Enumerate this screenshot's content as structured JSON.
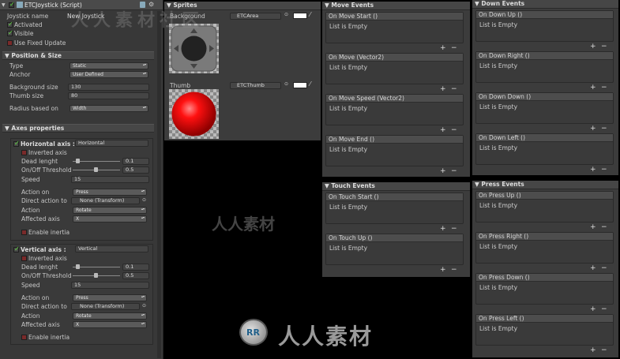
{
  "inspector": {
    "title": "ETCJoystick (Script)",
    "joystick_name_label": "Joystick name",
    "joystick_name_value": "New Joystick",
    "activated": "Activated",
    "visible": "Visible",
    "use_fixed_update": "Use Fixed Update",
    "position_size": {
      "title": "Position & Size",
      "type_label": "Type",
      "type_value": "Static",
      "anchor_label": "Anchor",
      "anchor_value": "User Defined",
      "bg_size_label": "Background size",
      "bg_size_value": "130",
      "thumb_size_label": "Thumb size",
      "thumb_size_value": "80",
      "radius_label": "Radius based on",
      "radius_value": "Width"
    },
    "axes": {
      "title": "Axes properties",
      "horizontal": {
        "title": "Horizontal axis :",
        "name": "Horizontal",
        "inverted": "Inverted axis",
        "dead_label": "Dead lenght",
        "dead_value": "0.1",
        "thresh_label": "On/Off Threshold",
        "thresh_value": "0.5",
        "speed_label": "Speed",
        "speed_value": "15",
        "action_on_label": "Action on",
        "action_on_value": "Press",
        "direct_label": "Direct action to",
        "direct_value": "None (Transform)",
        "action_label": "Action",
        "action_value": "Rotate",
        "affected_label": "Affected axis",
        "affected_value": "X",
        "inertia": "Enable inertia"
      },
      "vertical": {
        "title": "Vertical axis :",
        "name": "Vertical",
        "inverted": "Inverted axis",
        "dead_label": "Dead lenght",
        "dead_value": "0.1",
        "thresh_label": "On/Off Threshold",
        "thresh_value": "0.5",
        "speed_label": "Speed",
        "speed_value": "15",
        "action_on_label": "Action on",
        "action_on_value": "Press",
        "direct_label": "Direct action to",
        "direct_value": "None (Transform)",
        "action_label": "Action",
        "action_value": "Rotate",
        "affected_label": "Affected axis",
        "affected_value": "X",
        "inertia": "Enable inertia"
      }
    }
  },
  "sprites": {
    "title": "Sprites",
    "bg_label": "Background",
    "bg_value": "ETCArea",
    "thumb_label": "Thumb",
    "thumb_value": "ETCThumb"
  },
  "move_events": {
    "title": "Move Events",
    "items": [
      {
        "name": "On Move Start ()",
        "empty": "List is Empty"
      },
      {
        "name": "On Move (Vector2)",
        "empty": "List is Empty"
      },
      {
        "name": "On Move Speed (Vector2)",
        "empty": "List is Empty"
      },
      {
        "name": "On Move End ()",
        "empty": "List is Empty"
      }
    ]
  },
  "touch_events": {
    "title": "Touch Events",
    "items": [
      {
        "name": "On Touch Start ()",
        "empty": "List is Empty"
      },
      {
        "name": "On Touch Up ()",
        "empty": "List is Empty"
      }
    ]
  },
  "down_events": {
    "title": "Down Events",
    "items": [
      {
        "name": "On Down Up ()",
        "empty": "List is Empty"
      },
      {
        "name": "On Down Right ()",
        "empty": "List is Empty"
      },
      {
        "name": "On Down Down ()",
        "empty": "List is Empty"
      },
      {
        "name": "On Down Left ()",
        "empty": "List is Empty"
      }
    ]
  },
  "press_events": {
    "title": "Press Events",
    "items": [
      {
        "name": "On Press Up ()",
        "empty": "List is Empty"
      },
      {
        "name": "On Press Right ()",
        "empty": "List is Empty"
      },
      {
        "name": "On Press Down ()",
        "empty": "List is Empty"
      },
      {
        "name": "On Press Left ()",
        "empty": "List is Empty"
      }
    ]
  },
  "list_controls": {
    "add": "+",
    "remove": "−"
  },
  "watermark": {
    "text": "人人素材",
    "text_top": "人人素材社区",
    "mark": "RR"
  },
  "colors": {
    "check": "#5fdc3c",
    "thumb_red": "#ff0000",
    "watermark": "#9a9a9a"
  }
}
